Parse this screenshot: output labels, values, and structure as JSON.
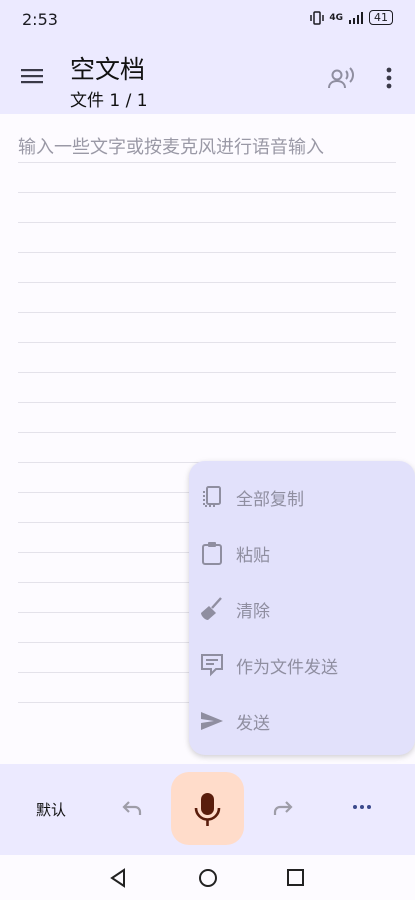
{
  "status": {
    "time": "2:53",
    "network": "4G",
    "battery": "41"
  },
  "header": {
    "title": "空文档",
    "subtitle": "文件 1 / 1"
  },
  "editor": {
    "placeholder": "输入一些文字或按麦克风进行语音输入"
  },
  "popup": {
    "items": [
      {
        "label": "全部复制",
        "icon": "copy-all-icon"
      },
      {
        "label": "粘贴",
        "icon": "paste-icon"
      },
      {
        "label": "清除",
        "icon": "broom-icon"
      },
      {
        "label": "作为文件发送",
        "icon": "send-as-file-icon"
      },
      {
        "label": "发送",
        "icon": "send-icon"
      }
    ]
  },
  "bottom": {
    "language_label": "默认"
  },
  "colors": {
    "accent": "#ffdcca",
    "bar": "#eceaff",
    "popup": "#e2e1fb",
    "muted": "#8f8ea0",
    "mic": "#5a1d0c",
    "dots": "#3b4a8c"
  }
}
